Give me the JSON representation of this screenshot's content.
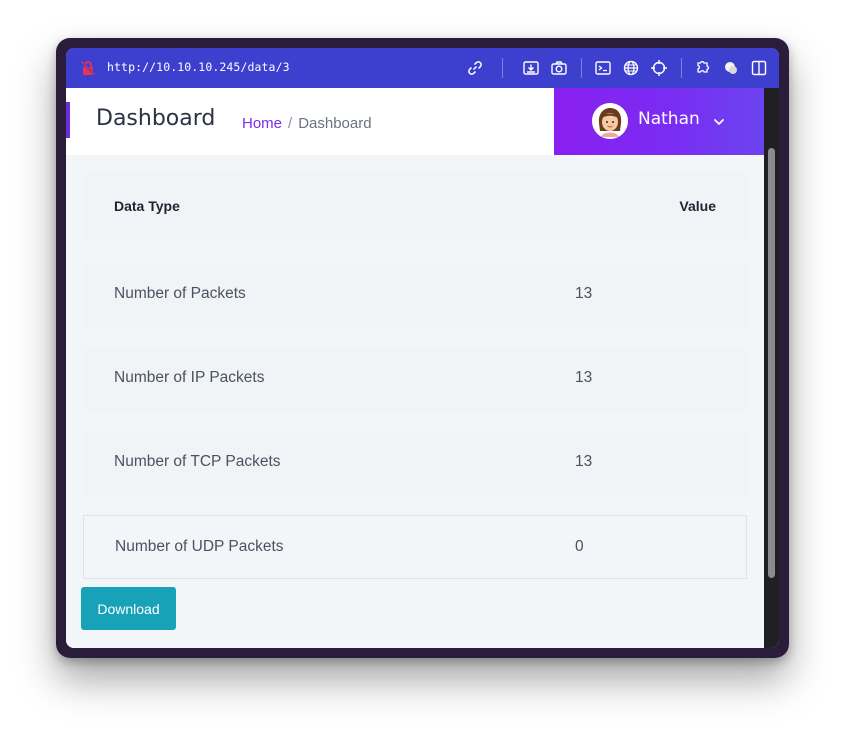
{
  "browser": {
    "url": "http://10.10.10.245/data/3"
  },
  "header": {
    "title": "Dashboard",
    "breadcrumb": {
      "home": "Home",
      "separator": "/",
      "current": "Dashboard"
    },
    "user": {
      "name": "Nathan"
    }
  },
  "table": {
    "columns": [
      "Data Type",
      "Value"
    ],
    "rows": [
      {
        "type": "Number of Packets",
        "value": "13"
      },
      {
        "type": "Number of IP Packets",
        "value": "13"
      },
      {
        "type": "Number of TCP Packets",
        "value": "13"
      },
      {
        "type": "Number of UDP Packets",
        "value": "0"
      }
    ]
  },
  "actions": {
    "download_label": "Download"
  },
  "colors": {
    "toolbar": "#3d3fcf",
    "accent": "#7a2ee6",
    "user_gradient_start": "#8a1ff0",
    "user_gradient_end": "#6b44f0",
    "download_button": "#17a2b8"
  }
}
